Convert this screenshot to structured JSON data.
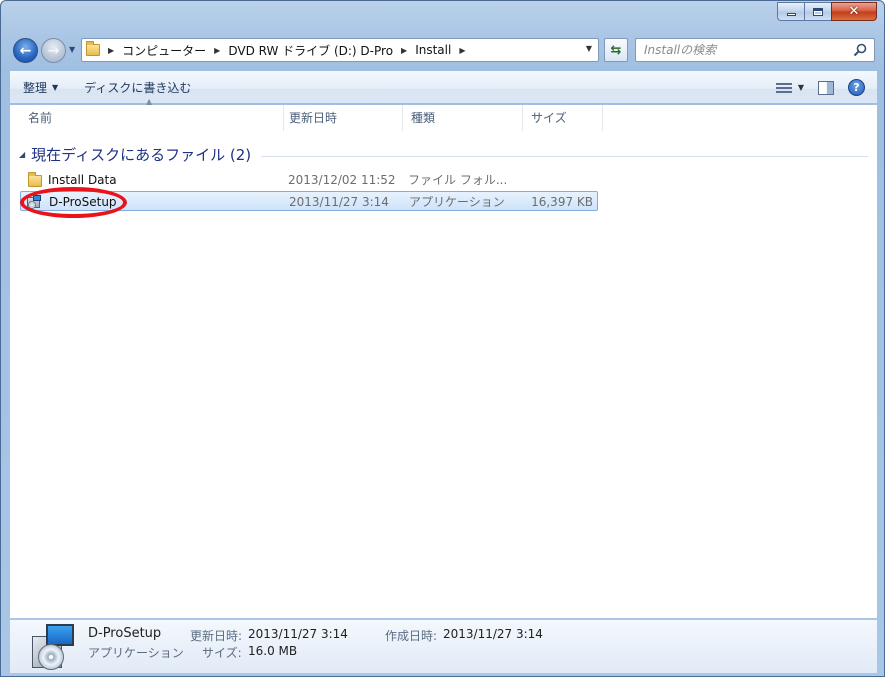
{
  "nav": {
    "path": [
      "コンピューター",
      "DVD RW ドライブ (D:) D-Pro",
      "Install"
    ],
    "search_placeholder": "Installの検索"
  },
  "toolbar": {
    "organize_label": "整理",
    "burn_label": "ディスクに書き込む"
  },
  "columns": {
    "name": "名前",
    "date": "更新日時",
    "type": "種類",
    "size": "サイズ"
  },
  "group": {
    "title": "現在ディスクにあるファイル (2)"
  },
  "files": [
    {
      "name": "Install Data",
      "date": "2013/12/02 11:52",
      "type": "ファイル フォル...",
      "size": "",
      "icon": "folder-icon",
      "selected": false
    },
    {
      "name": "D-ProSetup",
      "date": "2013/11/27 3:14",
      "type": "アプリケーション",
      "size": "16,397 KB",
      "icon": "setup-exe-icon",
      "selected": true
    }
  ],
  "details": {
    "name": "D-ProSetup",
    "type": "アプリケーション",
    "modified_label": "更新日時:",
    "modified_value": "2013/11/27 3:14",
    "created_label": "作成日時:",
    "created_value": "2013/11/27 3:14",
    "size_label": "サイズ:",
    "size_value": "16.0 MB"
  },
  "colors": {
    "highlight_ring": "#e8131b",
    "group_title": "#1e3287",
    "selection_border": "#84acdd"
  }
}
